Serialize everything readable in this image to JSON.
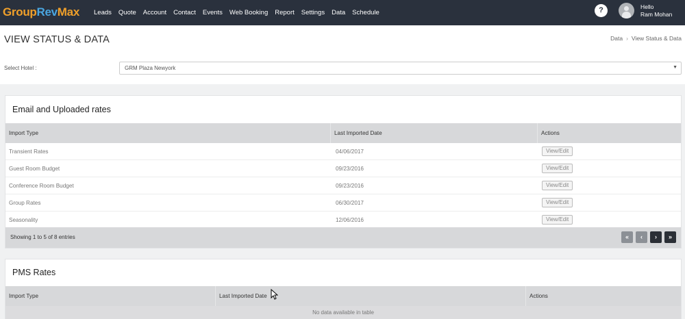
{
  "brand": {
    "part1": "Group",
    "part2": "Rev",
    "part3": "Max"
  },
  "nav": [
    "Leads",
    "Quote",
    "Account",
    "Contact",
    "Events",
    "Web Booking",
    "Report",
    "Settings",
    "Data",
    "Schedule"
  ],
  "header": {
    "help_label": "?",
    "hello": "Hello",
    "user_name": "Ram Mohan"
  },
  "page": {
    "title": "VIEW STATUS & DATA",
    "breadcrumb": [
      "Data",
      "View Status & Data"
    ]
  },
  "hotel": {
    "label": "Select Hotel :",
    "value": "GRM Plaza Newyork"
  },
  "email_rates": {
    "title": "Email and Uploaded rates",
    "columns": [
      "Import Type",
      "Last Imported Date",
      "Actions"
    ],
    "rows": [
      {
        "type": "Transient Rates",
        "date": "04/06/2017",
        "action": "View/Edit"
      },
      {
        "type": "Guest Room Budget",
        "date": "09/23/2016",
        "action": "View/Edit"
      },
      {
        "type": "Conference Room Budget",
        "date": "09/23/2016",
        "action": "View/Edit"
      },
      {
        "type": "Group Rates",
        "date": "06/30/2017",
        "action": "View/Edit"
      },
      {
        "type": "Seasonality",
        "date": "12/06/2016",
        "action": "View/Edit"
      }
    ],
    "showing": "Showing 1 to 5 of 8 entries",
    "pager": {
      "first": "«",
      "prev": "‹",
      "next": "›",
      "last": "»"
    }
  },
  "pms_rates": {
    "title": "PMS Rates",
    "columns": [
      "Import Type",
      "Last Imported Date",
      "Actions"
    ],
    "empty": "No data available in table"
  },
  "colors": {
    "nav_bg": "#2a313d",
    "brand_orange": "#f0a02a",
    "brand_blue": "#4aa6e0"
  }
}
